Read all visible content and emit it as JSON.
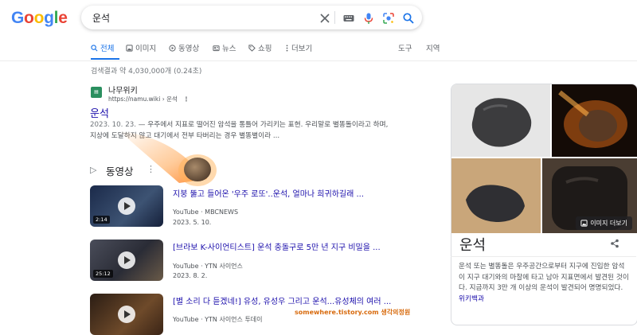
{
  "logo": {
    "letters": [
      "G",
      "o",
      "o",
      "g",
      "l",
      "e"
    ],
    "colors": [
      "#4285F4",
      "#EA4335",
      "#FBBC05",
      "#4285F4",
      "#34A853",
      "#EA4335"
    ]
  },
  "search": {
    "query": "운석"
  },
  "tabs": [
    {
      "label": "전체",
      "icon": "search-icon"
    },
    {
      "label": "이미지",
      "icon": "image-icon"
    },
    {
      "label": "동영상",
      "icon": "video-icon"
    },
    {
      "label": "뉴스",
      "icon": "news-icon"
    },
    {
      "label": "쇼핑",
      "icon": "tag-icon"
    },
    {
      "label": "더보기",
      "icon": "more-vert-icon"
    }
  ],
  "tools": {
    "tools_label": "도구",
    "region_label": "지역"
  },
  "stats": "검색결과 약 4,030,000개 (0.24초)",
  "result": {
    "site_name": "나무위키",
    "url": "https://namu.wiki › 운석",
    "title": "운석",
    "date": "2023. 10. 23.",
    "snippet": " — 우주에서 지표로 떨어진 암석을 통틀어 가리키는 표현. 우리말로 별똥돌이라고 하며, 지상에 도달하지 않고 대기에서 전부 타버리는 경우 별똥별이라 ..."
  },
  "videos": {
    "header": "동영상",
    "items": [
      {
        "title": "지붕 뚫고 들어온 '우주 로또'..운석, 얼마나 희귀하길래 ...",
        "source": "YouTube · MBCNEWS",
        "date": "2023. 5. 10.",
        "duration": "2:14",
        "thumb_color": "#1b2a4a"
      },
      {
        "title": "[브라보 K-사이언티스트] 운석 충돌구로 5만 년 지구 비밀을 ...",
        "source": "YouTube · YTN 사이언스",
        "date": "2023. 8. 2.",
        "duration": "25:12",
        "thumb_color": "#3a3a4a"
      },
      {
        "title": "[별 소리 다 듣겠네!] 유성, 유성우 그리고 운석...유성체의 여러 ...",
        "source": "YouTube · YTN 사이언스 투데이",
        "date": "",
        "duration": "",
        "thumb_color": "#2b1d14"
      }
    ]
  },
  "knowledge_panel": {
    "title": "운석",
    "more_images_label": "이미지 더보기",
    "description": "운석 또는 별똥돌은 우주공간으로부터 지구에 진입한 암석이 지구 대기와의 마찰에 타고 남아 지표면에서 발견된 것이다. 지금까지 3만 개 이상의 운석이 발견되어 명명되었다.",
    "wiki_link": "위키백과"
  },
  "watermark": "somewhere.tistory.com 생각의정원"
}
